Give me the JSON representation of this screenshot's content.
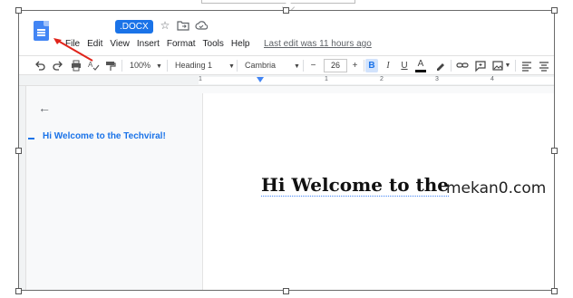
{
  "titlebar": {
    "badge": ".DOCX",
    "icons": [
      "star-icon",
      "folder-move-icon",
      "cloud-status-icon"
    ]
  },
  "menu": {
    "items": [
      "File",
      "Edit",
      "View",
      "Insert",
      "Format",
      "Tools",
      "Help"
    ],
    "last_edit": "Last edit was 11 hours ago"
  },
  "toolbar": {
    "zoom": "100%",
    "style": "Heading 1",
    "font": "Cambria",
    "minus": "−",
    "font_size": "26",
    "plus": "+",
    "bold": "B",
    "italic": "I",
    "underline": "U",
    "text_color": "A"
  },
  "ruler": {
    "numbers": [
      "1",
      "1",
      "2",
      "3",
      "4"
    ]
  },
  "outline": {
    "items": [
      "Hi Welcome to the Techviral!"
    ]
  },
  "document": {
    "heading": "Hi Welcome to the"
  },
  "watermark": "mekan0.com",
  "colors": {
    "accent": "#1a73e8",
    "annotation": "#e0241b"
  }
}
